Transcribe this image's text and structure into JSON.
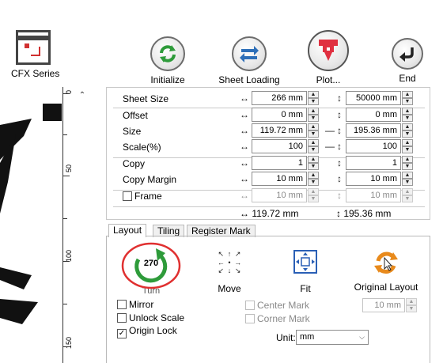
{
  "toolbar": {
    "device_label": "CFX Series",
    "initialize_label": "Initialize",
    "sheet_loading_label": "Sheet Loading",
    "plot_label": "Plot...",
    "end_label": "End"
  },
  "settings": {
    "sheet_size": {
      "label": "Sheet Size",
      "width": "266 mm",
      "height": "50000 mm"
    },
    "offset": {
      "label": "Offset",
      "x": "0 mm",
      "y": "0 mm"
    },
    "size": {
      "label": "Size",
      "width": "119.72 mm",
      "height": "195.36 mm"
    },
    "scale": {
      "label": "Scale(%)",
      "x": "100",
      "y": "100"
    },
    "copy": {
      "label": "Copy",
      "x": "1",
      "y": "1"
    },
    "copy_margin": {
      "label": "Copy Margin",
      "x": "10 mm",
      "y": "10 mm"
    },
    "frame": {
      "label": "Frame",
      "x": "10 mm",
      "y": "10 mm",
      "checked": false
    },
    "total_width": "↔ 119.72 mm",
    "total_height": "↕ 195.36 mm"
  },
  "tabs": [
    {
      "label": "Layout",
      "active": true
    },
    {
      "label": "Tiling",
      "active": false
    },
    {
      "label": "Register Mark",
      "active": false
    }
  ],
  "layout": {
    "turn_value": "270",
    "turn_label": "Turn",
    "move_label": "Move",
    "fit_label": "Fit",
    "original_layout_label": "Original Layout",
    "mirror_label": "Mirror",
    "unlock_scale_label": "Unlock Scale",
    "origin_lock_label": "Origin Lock",
    "center_mark_label": "Center Mark",
    "corner_mark_label": "Corner Mark",
    "mark_size": "10 mm",
    "unit_label": "Unit:",
    "unit_value": "mm"
  },
  "ruler": {
    "labels": [
      "0",
      "50",
      "100",
      "150"
    ]
  },
  "colors": {
    "initialize": "#2e9b3a",
    "sheet_loading": "#2e6fb8",
    "plot": "#e03040",
    "turn_ring": "#e03030",
    "turn_arrow": "#2e9b3a",
    "fit": "#2a5fb5",
    "original_layout": "#e88a1c"
  }
}
